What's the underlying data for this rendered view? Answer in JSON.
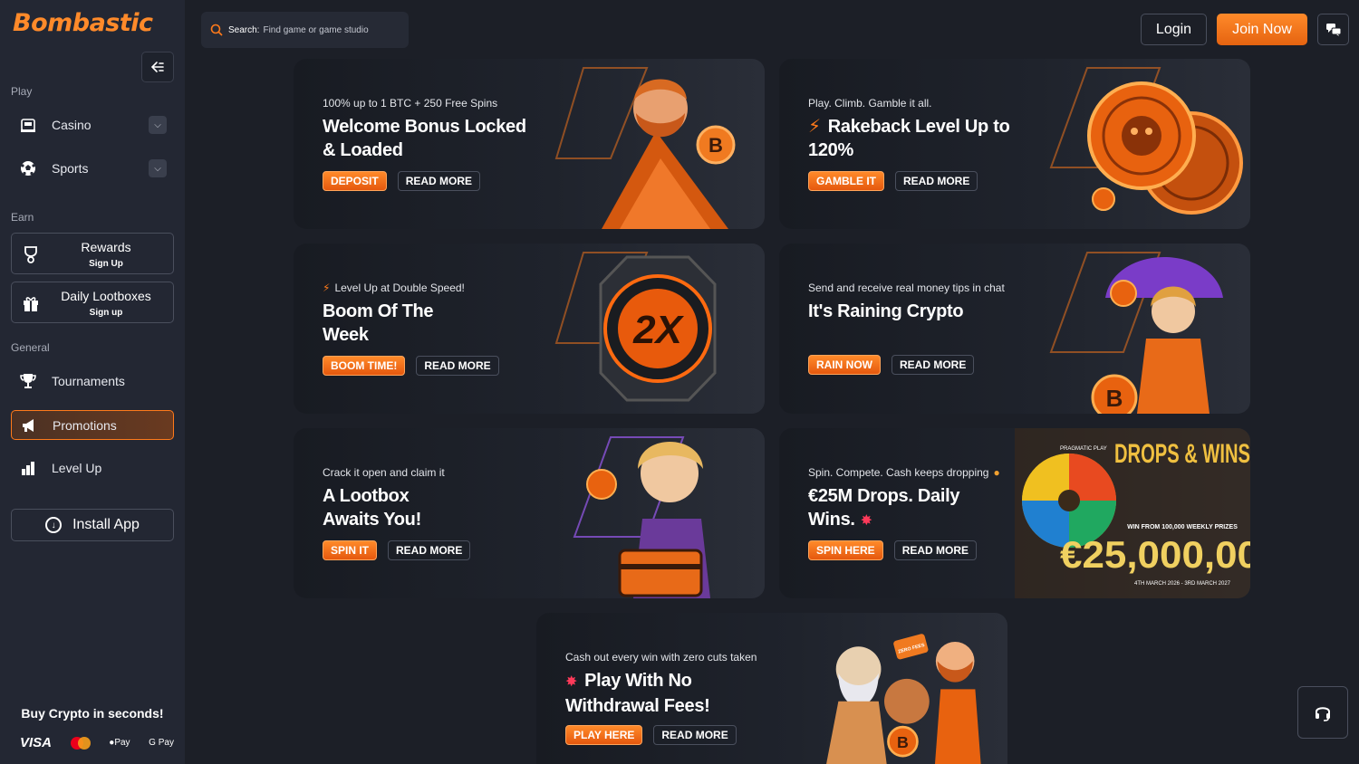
{
  "brand": {
    "logo_text": "Bombastic",
    "accent": "#ff7a1a"
  },
  "sidebar": {
    "collapse_icon": "collapse-left-icon",
    "sections": {
      "play": "Play",
      "earn": "Earn",
      "general": "General"
    },
    "play_items": [
      {
        "label": "Casino",
        "icon": "casino-icon"
      },
      {
        "label": "Sports",
        "icon": "soccer-ball-icon"
      }
    ],
    "earn_items": [
      {
        "label": "Rewards",
        "sublabel": "Sign Up",
        "icon": "trophy-icon"
      },
      {
        "label": "Daily Lootboxes",
        "sublabel": "Sign up",
        "icon": "gift-icon"
      }
    ],
    "general_items": [
      {
        "label": "Tournaments",
        "icon": "cup-icon"
      },
      {
        "label": "Promotions",
        "icon": "megaphone-icon",
        "active": true
      },
      {
        "label": "Level Up",
        "icon": "bar-chart-icon"
      }
    ],
    "install_label": "Install App",
    "buy_crypto": "Buy Crypto in seconds!",
    "payments": {
      "visa": "VISA",
      "apple": "Pay",
      "google": "G Pay"
    }
  },
  "header": {
    "search_label": "Search:",
    "search_placeholder": "Find game or game studio",
    "login": "Login",
    "join": "Join Now"
  },
  "promos": [
    {
      "subtitle": "100% up to 1 BTC + 250 Free Spins",
      "title": "Welcome Bonus Locked & Loaded",
      "primary": "DEPOSIT",
      "secondary": "READ MORE"
    },
    {
      "subtitle": "Play. Climb. Gamble it all.",
      "title": "Rakeback Level Up to 120%",
      "primary": "GAMBLE IT",
      "secondary": "READ MORE"
    },
    {
      "subtitle": "Level Up at Double Speed!",
      "title": "Boom Of The Week",
      "primary": "BOOM TIME!",
      "secondary": "READ MORE"
    },
    {
      "subtitle": "Send and receive real money tips in chat",
      "title": "It's Raining Crypto",
      "primary": "RAIN NOW",
      "secondary": "READ MORE"
    },
    {
      "subtitle": "Crack it open and claim it",
      "title": "A Lootbox Awaits You!",
      "primary": "SPIN IT",
      "secondary": "READ MORE"
    },
    {
      "subtitle": "Spin. Compete. Cash keeps dropping",
      "title": "€25M Drops. Daily Wins.",
      "primary": "SPIN HERE",
      "secondary": "READ MORE"
    },
    {
      "subtitle": "Cash out every win with zero cuts taken",
      "title": "Play With No Withdrawal Fees!",
      "primary": "PLAY HERE",
      "secondary": "READ MORE"
    }
  ],
  "art_text": {
    "multiplier": "2X",
    "drops_title": "DROPS & WINS",
    "drops_prize": "€25,000,00",
    "drops_provider": "PRAGMATIC PLAY",
    "drops_weekly": "WIN FROM 100,000 WEEKLY PRIZES",
    "drops_dates": "4TH MARCH 2026 - 3RD MARCH 2027",
    "zero_fees": "ZERO FEES"
  }
}
